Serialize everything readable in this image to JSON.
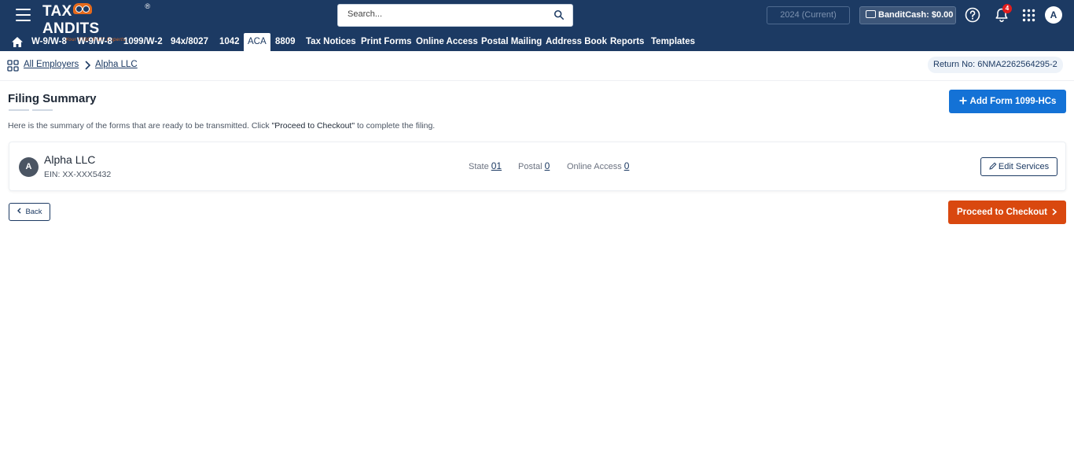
{
  "header": {
    "logo_text_left": "TAX",
    "logo_text_right": "ANDITS",
    "logo_reg": "®",
    "logo_tagline": "Your 1099 & W2 Experts",
    "search_placeholder": "Search...",
    "year_label": "2024 (Current)",
    "bandit_cash_label": "BanditCash: $0.00",
    "notification_count": "4",
    "user_initial": "A"
  },
  "nav": {
    "items": [
      {
        "label": "W-9/W-8"
      },
      {
        "label": "W-9/W-8"
      },
      {
        "label": "1099/W-2"
      },
      {
        "label": "94x/8027"
      },
      {
        "label": "1042"
      },
      {
        "label": "ACA"
      },
      {
        "label": "8809"
      },
      {
        "label": "Tax Notices"
      },
      {
        "label": "Print Forms"
      },
      {
        "label": "Online Access"
      },
      {
        "label": "Postal Mailing"
      },
      {
        "label": "Address Book"
      },
      {
        "label": "Reports"
      },
      {
        "label": "Templates"
      }
    ],
    "active": "ACA"
  },
  "breadcrumb": {
    "root": "All Employers",
    "current": "Alpha LLC",
    "return_no": "Return No: 6NMA2262564295-2"
  },
  "main": {
    "title": "Filing Summary",
    "add_button": "Add Form 1099-HCs",
    "description_pre": "Here is the summary of the forms that are ready to be transmitted. Click ",
    "description_quote": "\"Proceed to Checkout\"",
    "description_post": " to complete the filing.",
    "employer": {
      "initial": "A",
      "name": "Alpha LLC",
      "ein": "EIN: XX-XXX5432",
      "state_label": "State",
      "state_value": "01",
      "postal_label": "Postal",
      "postal_value": "0",
      "online_label": "Online Access",
      "online_value": "0",
      "edit_button": "Edit Services"
    },
    "back_button": "Back",
    "checkout_button": "Proceed to Checkout"
  },
  "colors": {
    "header_bg": "#1c3a63",
    "primary_blue": "#1472d6",
    "checkout_orange": "#d9480f",
    "logo_orange": "#e56a1c",
    "badge_red": "#e11d1d"
  }
}
